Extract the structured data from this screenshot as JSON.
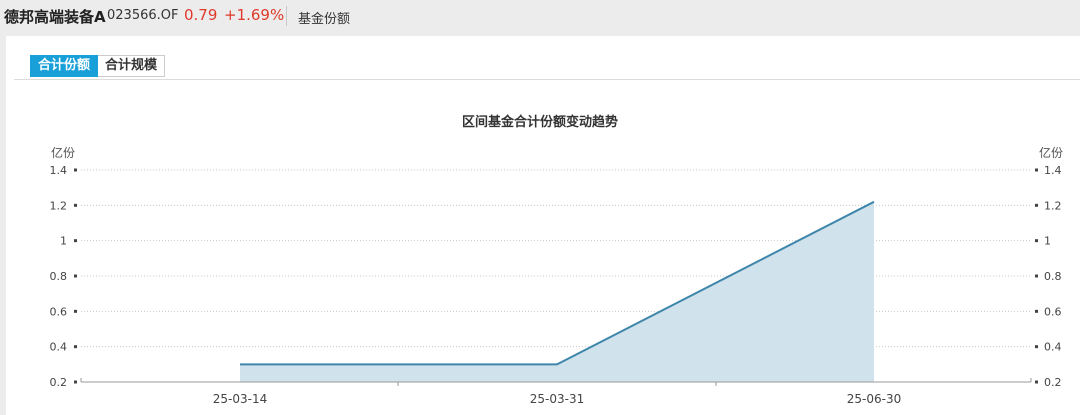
{
  "header": {
    "fund_name": "德邦高端装备A",
    "fund_code": "023566.OF",
    "price": "0.79",
    "change": "+1.69%",
    "section": "基金份额"
  },
  "tabs": [
    {
      "label": "合计份额",
      "active": true
    },
    {
      "label": "合计规模",
      "active": false
    }
  ],
  "colors": {
    "accent": "#1aa0d8",
    "up": "#e0392b",
    "line": "#3f86ab",
    "area": "#d0e2ec"
  },
  "chart_data": {
    "type": "area",
    "title": "区间基金合计份额变动趋势",
    "ylabel_left": "亿份",
    "ylabel_right": "亿份",
    "x": [
      "25-03-14",
      "25-03-31",
      "25-06-30"
    ],
    "series": [
      {
        "values": [
          0.3,
          0.3,
          1.22
        ]
      }
    ],
    "yticks": [
      "0.2",
      "0.4",
      "0.6",
      "0.8",
      "1",
      "1.2",
      "1.4"
    ],
    "ylim": [
      0.2,
      1.4
    ],
    "grid": true
  }
}
